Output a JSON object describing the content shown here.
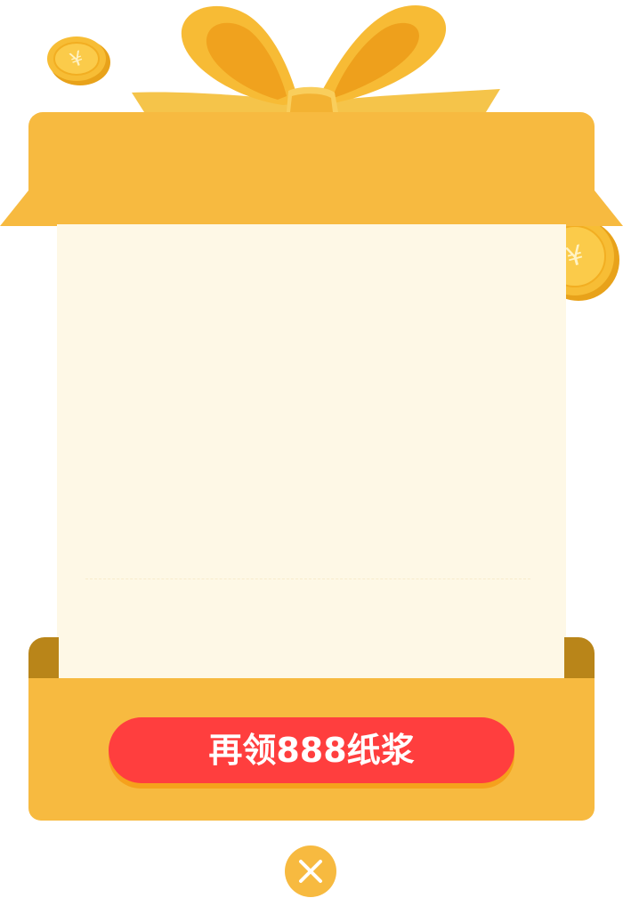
{
  "popup": {
    "cta_label": "再领888纸浆"
  },
  "icons": {
    "coin": "yuan-coin-icon",
    "close": "close-icon",
    "bow": "ribbon-bow-icon"
  },
  "colors": {
    "box": "#F7BA40",
    "box_dark": "#B98519",
    "paper": "#FEF8E6",
    "cta": "#FF3E3E",
    "cta_shadow": "#F5A11C",
    "coin": "#F6B52A"
  }
}
